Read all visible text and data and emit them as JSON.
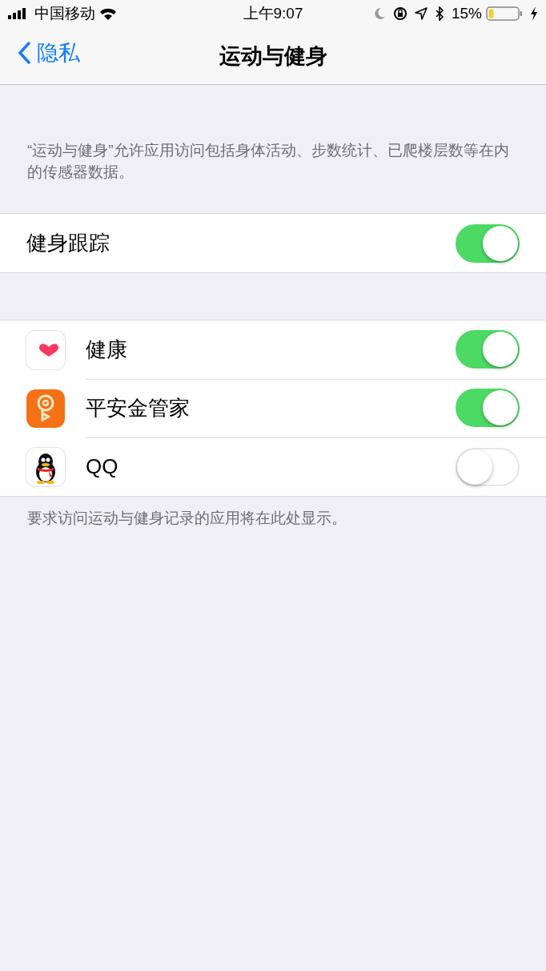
{
  "status_bar": {
    "carrier": "中国移动",
    "time": "上午9:07",
    "battery_percent": "15%"
  },
  "nav": {
    "back": "隐私",
    "title": "运动与健身"
  },
  "description": "“运动与健身”允许应用访问包括身体活动、步数统计、已爬楼层数等在内的传感器数据。",
  "fitness_tracking": {
    "label": "健身跟踪",
    "on": true
  },
  "apps": [
    {
      "kind": "heart",
      "name": "健康",
      "on": true
    },
    {
      "kind": "key",
      "name": "平安金管家",
      "on": true
    },
    {
      "kind": "penguin",
      "name": "QQ",
      "on": false
    }
  ],
  "footer": "要求访问运动与健身记录的应用将在此处显示。"
}
